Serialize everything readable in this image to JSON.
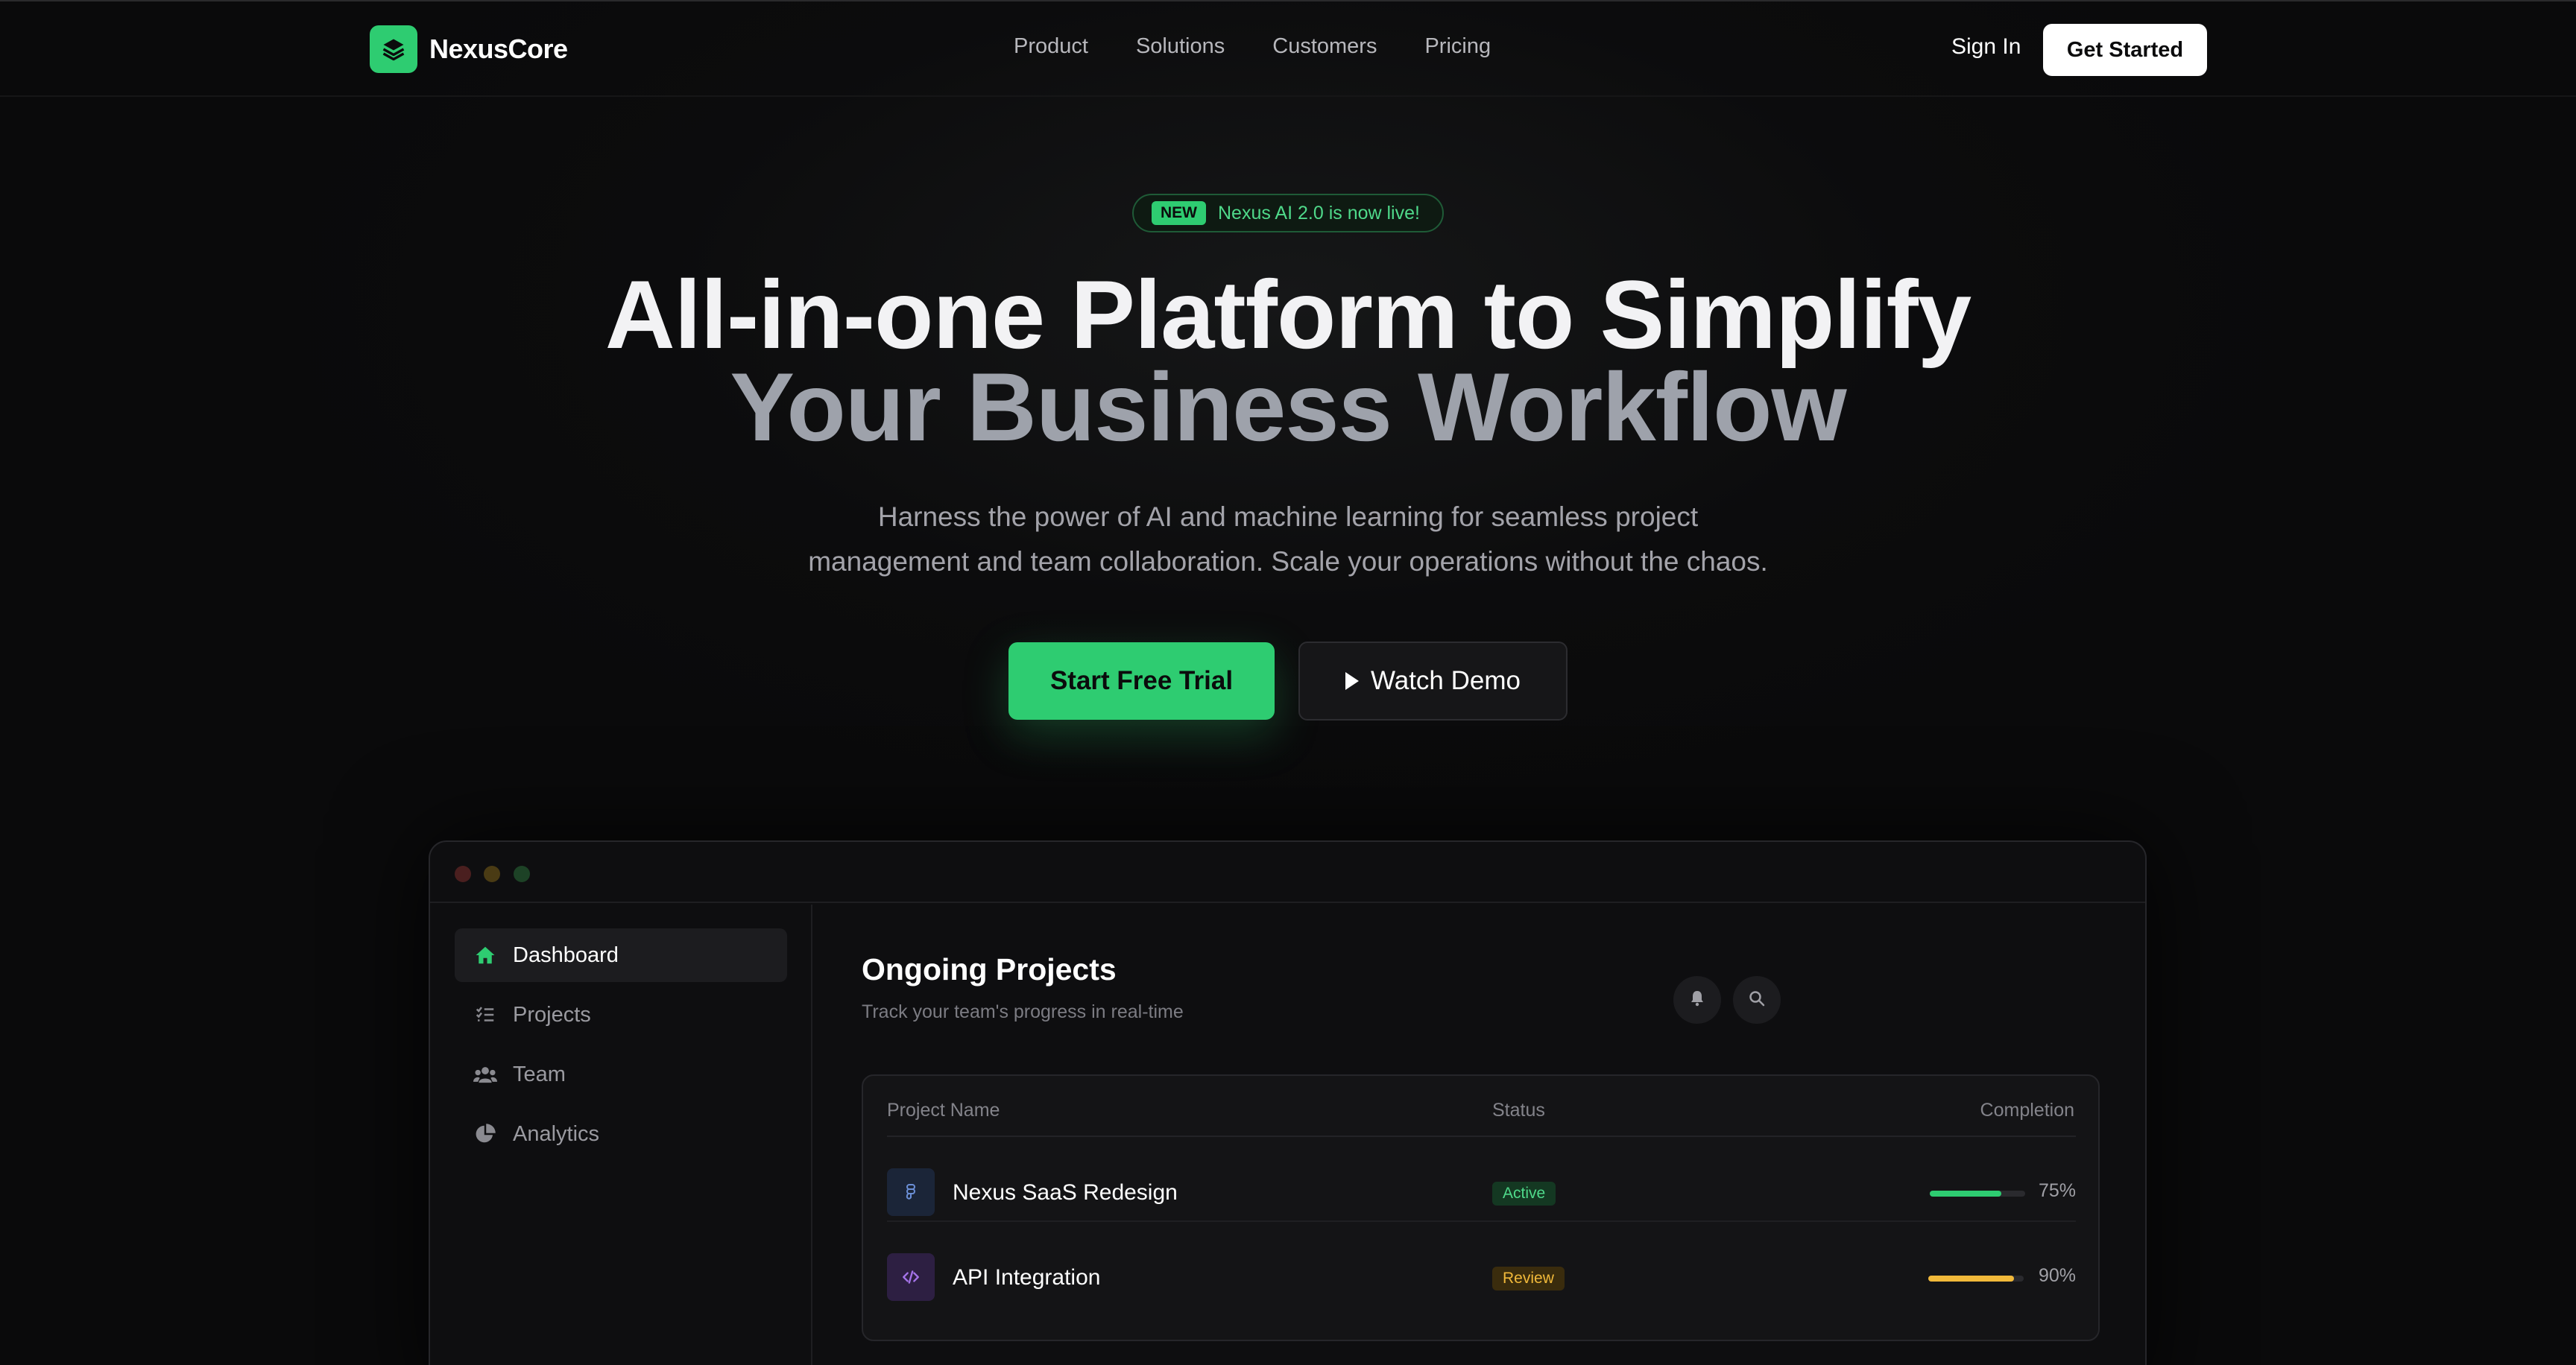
{
  "brand": {
    "name": "NexusCore",
    "logo_icon": "layers-icon",
    "accent": "#2ecc71"
  },
  "nav": {
    "links": [
      "Product",
      "Solutions",
      "Customers",
      "Pricing"
    ],
    "signin": "Sign In",
    "get_started": "Get Started"
  },
  "hero": {
    "badge_tag": "NEW",
    "badge_text": "Nexus AI 2.0 is now live!",
    "title_line1": "All-in-one Platform to Simplify",
    "title_line2": "Your Business Workflow",
    "subtitle_line1": "Harness the power of AI and machine learning for seamless project",
    "subtitle_line2": "management and team collaboration. Scale your operations without the chaos.",
    "cta_primary": "Start Free Trial",
    "cta_secondary": "Watch Demo"
  },
  "app": {
    "sidebar": [
      {
        "label": "Dashboard",
        "icon": "home-icon",
        "active": true
      },
      {
        "label": "Projects",
        "icon": "tasks-icon",
        "active": false
      },
      {
        "label": "Team",
        "icon": "users-icon",
        "active": false
      },
      {
        "label": "Analytics",
        "icon": "pie-chart-icon",
        "active": false
      }
    ],
    "main": {
      "title": "Ongoing Projects",
      "subtitle": "Track your team's progress in real-time"
    },
    "table": {
      "headers": {
        "name": "Project Name",
        "status": "Status",
        "completion": "Completion"
      },
      "rows": [
        {
          "name": "Nexus SaaS Redesign",
          "icon": "figma-icon",
          "status": "Active",
          "completion": 0.75,
          "completion_label": "75%",
          "bar_color": "#2ecc71"
        },
        {
          "name": "API Integration",
          "icon": "code-icon",
          "status": "Review",
          "completion": 0.9,
          "completion_label": "90%",
          "bar_color": "#f1b93a"
        }
      ]
    }
  }
}
